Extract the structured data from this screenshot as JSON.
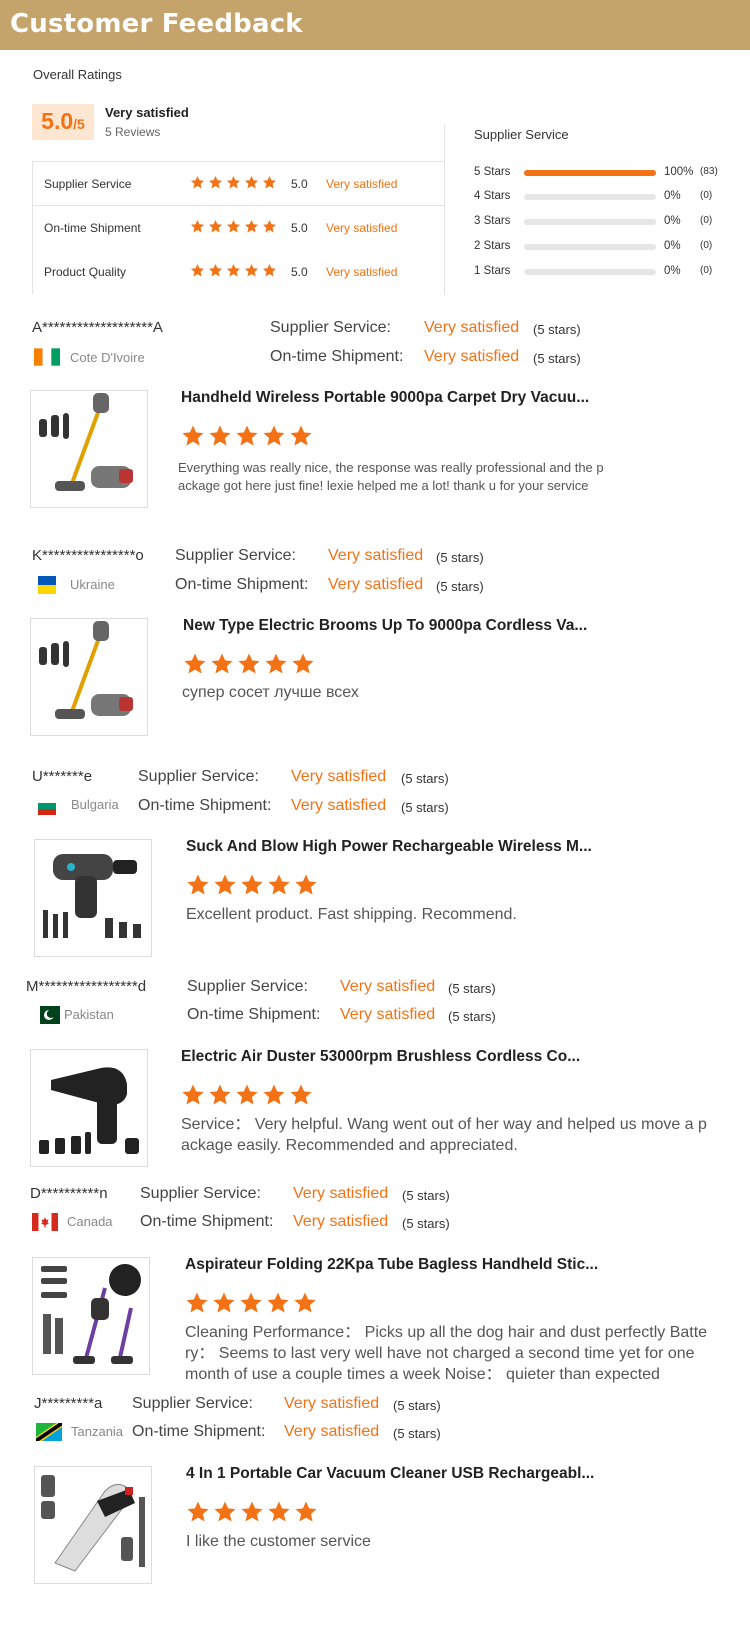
{
  "header": {
    "title": "Customer Feedback"
  },
  "overall": {
    "label": "Overall Ratings",
    "score": "5.0",
    "score_suffix": "/5",
    "satisfaction": "Very satisfied",
    "reviews": "5 Reviews",
    "rows": [
      {
        "name": "Supplier Service",
        "value": "5.0",
        "satisfaction": "Very satisfied",
        "stars": 5
      },
      {
        "name": "On-time Shipment",
        "value": "5.0",
        "satisfaction": "Very satisfied",
        "stars": 5
      },
      {
        "name": "Product Quality",
        "value": "5.0",
        "satisfaction": "Very satisfied",
        "stars": 5
      }
    ]
  },
  "supplier_service": {
    "title": "Supplier Service",
    "distribution": [
      {
        "label": "5  Stars",
        "percent": "100%",
        "count": "(83)",
        "fill": 1.0
      },
      {
        "label": "4  Stars",
        "percent": "0%",
        "count": "(0)",
        "fill": 0
      },
      {
        "label": "3  Stars",
        "percent": "0%",
        "count": "(0)",
        "fill": 0
      },
      {
        "label": "2  Stars",
        "percent": "0%",
        "count": "(0)",
        "fill": 0
      },
      {
        "label": "1  Stars",
        "percent": "0%",
        "count": "(0)",
        "fill": 0
      }
    ]
  },
  "rating_labels": {
    "supplier": "Supplier Service:",
    "shipment": "On-time Shipment:",
    "satisfaction": "Very satisfied",
    "count": "(5 stars)"
  },
  "reviews": [
    {
      "reviewer": "A*******************A",
      "country": "Cote D'Ivoire",
      "flag": "cote-divoire",
      "product_title": "Handheld Wireless Portable 9000pa Carpet Dry Vacuu...",
      "stars": 5,
      "text_lines": [
        "Everything was really nice, the response was really professional and the p",
        "ackage got here just fine! lexie helped me a lot! thank u for your service"
      ]
    },
    {
      "reviewer": "K****************o",
      "country": "Ukraine",
      "flag": "ukraine",
      "product_title": "New Type Electric Brooms Up To 9000pa Cordless Va...",
      "stars": 5,
      "text_lines": [
        "супер сосет лучше всех"
      ]
    },
    {
      "reviewer": "U*******e",
      "country": "Bulgaria",
      "flag": "bulgaria",
      "product_title": "Suck And Blow High Power Rechargeable Wireless M...",
      "stars": 5,
      "text_lines": [
        "Excellent product. Fast shipping. Recommend."
      ]
    },
    {
      "reviewer": "M*****************d",
      "country": "Pakistan",
      "flag": "pakistan",
      "product_title": "Electric Air Duster 53000rpm Brushless Cordless Co...",
      "stars": 5,
      "text_lines": [
        "Service：  Very helpful. Wang went out of her way and helped us move a p",
        "ackage easily. Recommended and appreciated."
      ]
    },
    {
      "reviewer": "D**********n",
      "country": "Canada",
      "flag": "canada",
      "product_title": "Aspirateur Folding 22Kpa Tube Bagless Handheld Stic...",
      "stars": 5,
      "text_lines": [
        "Cleaning Performance：  Picks up all the dog hair and dust perfectly Batte",
        "ry：  Seems to last very well have not charged a second time yet for one",
        "month of use a couple times a week Noise：  quieter than expected"
      ]
    },
    {
      "reviewer": "J*********a",
      "country": "Tanzania",
      "flag": "tanzania",
      "product_title": "4 In 1 Portable Car Vacuum Cleaner USB Rechargeabl...",
      "stars": 5,
      "text_lines": [
        "I like the customer service"
      ]
    }
  ]
}
